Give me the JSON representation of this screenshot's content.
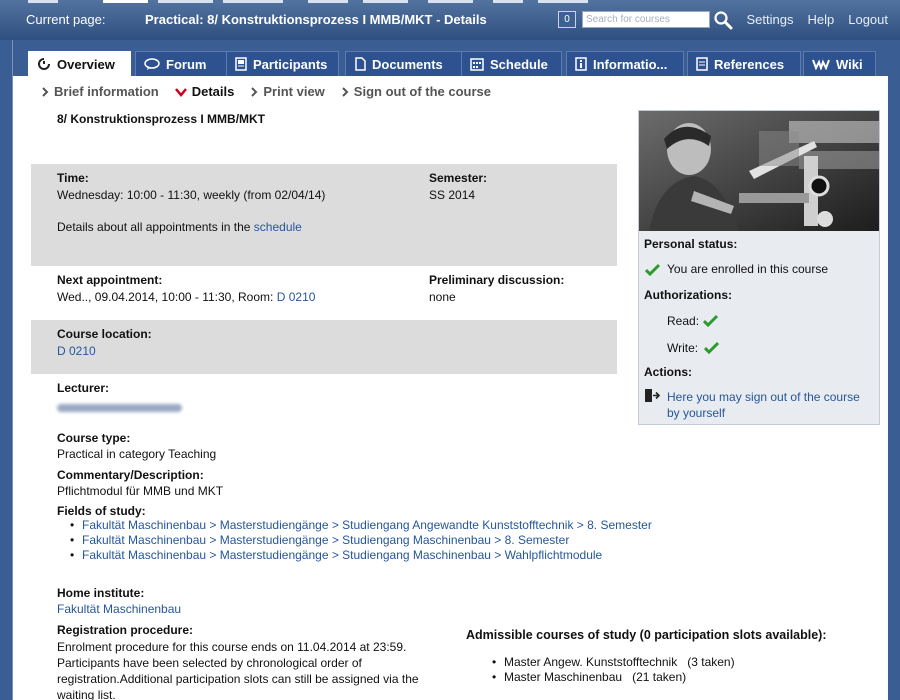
{
  "header": {
    "current_page_label": "Current page:",
    "current_page_value": "Practical: 8/ Konstruktionsprozess I MMB/MKT - Details",
    "badge_count": "0",
    "search_placeholder": "Search for courses",
    "links": [
      "Settings",
      "Help",
      "Logout"
    ]
  },
  "tabs": [
    {
      "label": "Overview",
      "icon": "overview-icon"
    },
    {
      "label": "Forum",
      "icon": "forum-icon"
    },
    {
      "label": "Participants",
      "icon": "participants-icon"
    },
    {
      "label": "Documents",
      "icon": "documents-icon"
    },
    {
      "label": "Schedule",
      "icon": "schedule-icon"
    },
    {
      "label": "Informatio...",
      "icon": "info-icon"
    },
    {
      "label": "References",
      "icon": "references-icon"
    },
    {
      "label": "Wiki",
      "icon": "wiki-icon"
    }
  ],
  "subnav": [
    {
      "label": "Brief information"
    },
    {
      "label": "Details"
    },
    {
      "label": "Print view"
    },
    {
      "label": "Sign out of the course"
    }
  ],
  "course": {
    "title": "8/ Konstruktionsprozess I MMB/MKT",
    "time_label": "Time:",
    "time_value": "Wednesday: 10:00 - 11:30, weekly (from 02/04/14)",
    "details_text": "Details about all appointments in the",
    "details_link": "schedule",
    "semester_label": "Semester:",
    "semester_value": "SS 2014",
    "next_label": "Next appointment:",
    "next_value": "Wed.., 09.04.2014, 10:00 - 11:30, Room:",
    "next_room": "D 0210",
    "prelim_label": "Preliminary discussion:",
    "prelim_value": "none",
    "location_label": "Course location:",
    "location_value": "D 0210",
    "lecturer_label": "Lecturer:",
    "course_type_label": "Course type:",
    "course_type_value": "Practical in category Teaching",
    "commentary_label": "Commentary/Description:",
    "commentary_value": "Pflichtmodul für MMB und MKT",
    "fields_label": "Fields of study:",
    "fields": [
      "Fakultät Maschinenbau > Masterstudiengänge > Studiengang Angewandte Kunststofftechnik > 8. Semester",
      "Fakultät Maschinenbau > Masterstudiengänge > Studiengang Maschinenbau > 8. Semester",
      "Fakultät Maschinenbau > Masterstudiengänge > Studiengang Maschinenbau > Wahlpflichtmodule"
    ],
    "home_label": "Home institute:",
    "home_value": "Fakultät Maschinenbau",
    "registration_label": "Registration procedure:",
    "registration_lines": [
      "Enrolment procedure for this course ends on 11.04.2014 at 23:59.",
      "Participants have been selected by chronological order of",
      "registration.Additional participation slots can still be assigned via the",
      "waiting list."
    ],
    "admissible_label": "Admissible courses of study (0 participation slots available):",
    "admissible": [
      {
        "name": "Master Angew. Kunststofftechnik",
        "taken": "(3 taken)"
      },
      {
        "name": "Master Maschinenbau",
        "taken": "(21 taken)"
      }
    ]
  },
  "sidebar": {
    "personal_status_label": "Personal status:",
    "enrolled_text": "You are enrolled in this course",
    "authorizations_label": "Authorizations:",
    "read_label": "Read:",
    "write_label": "Write:",
    "actions_label": "Actions:",
    "signout_line1": "Here you may sign out of the course",
    "signout_line2": "by yourself"
  },
  "colors": {
    "header_bg": "#2f4f80",
    "tab_bg": "#2e5290",
    "link": "#26569c",
    "check": "#2e9a2e",
    "grey_row": "#dcdcdc",
    "subnav_active_arrow": "#d0001a"
  }
}
